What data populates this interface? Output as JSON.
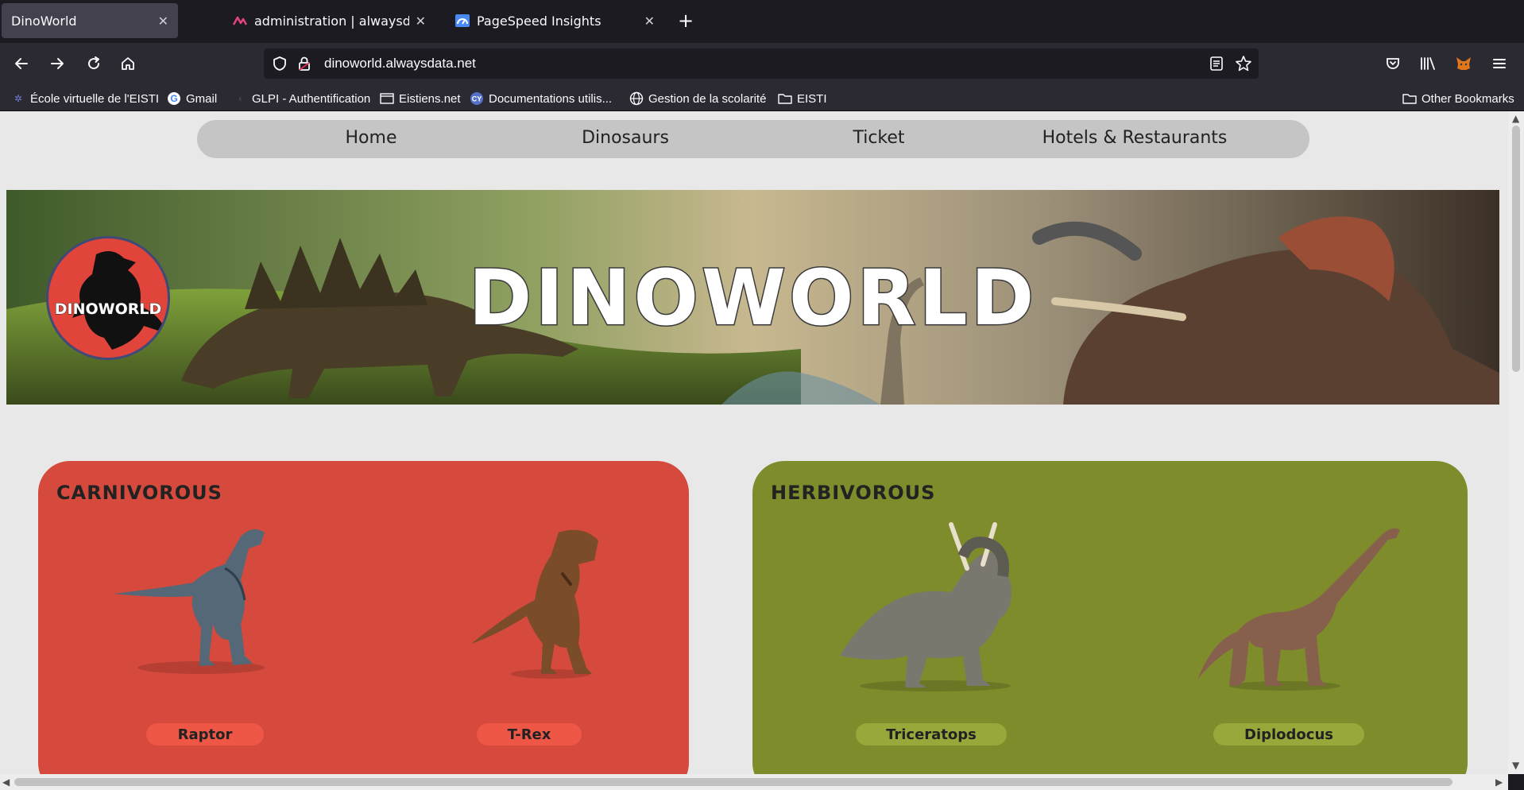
{
  "browser": {
    "tabs": [
      {
        "title": "DinoWorld",
        "icon": "none"
      },
      {
        "title": "administration | alwaysdata",
        "icon": "alwaysdata-icon"
      },
      {
        "title": "PageSpeed Insights",
        "icon": "pagespeed-icon"
      }
    ],
    "url": "dinoworld.alwaysdata.net",
    "bookmarks": [
      {
        "label": "École virtuelle de l'EISTI",
        "icon": "eisti-icon"
      },
      {
        "label": "Gmail",
        "icon": "google-icon"
      },
      {
        "label": "GLPI - Authentification",
        "icon": "glpi-icon"
      },
      {
        "label": "Eistiens.net",
        "icon": "page-icon"
      },
      {
        "label": "Documentations utilis...",
        "icon": "cy-icon"
      },
      {
        "label": "Gestion de la scolarité",
        "icon": "globe-icon"
      },
      {
        "label": "EISTI",
        "icon": "folder-icon"
      }
    ],
    "other_bookmarks": "Other Bookmarks"
  },
  "site": {
    "nav": [
      "Home",
      "Dinosaurs",
      "Ticket",
      "Hotels & Restaurants"
    ],
    "banner_title": "DINOWORLD",
    "logo_text": "DINOWORLD",
    "carnivorous": {
      "title": "CARNIVOROUS",
      "dinos": [
        "Raptor",
        "T-Rex"
      ]
    },
    "herbivorous": {
      "title": "HERBIVOROUS",
      "dinos": [
        "Triceratops",
        "Diplodocus"
      ]
    }
  },
  "colors": {
    "carnivorous_bg": "#d54a3c",
    "herbivorous_bg": "#7e8c2c",
    "page_bg": "#e8e8e8",
    "nav_bg": "#c5c5c5"
  }
}
